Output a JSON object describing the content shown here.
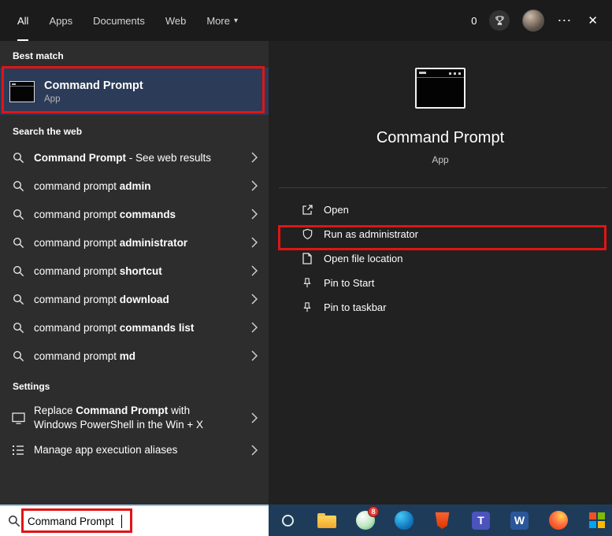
{
  "topbar": {
    "tabs": [
      {
        "label": "All"
      },
      {
        "label": "Apps"
      },
      {
        "label": "Documents"
      },
      {
        "label": "Web"
      },
      {
        "label": "More"
      }
    ],
    "rewards_count": "0"
  },
  "icons": {
    "caret_down": "▾",
    "ellipsis": "⋯",
    "close": "✕",
    "teams_letter": "T",
    "word_letter": "W"
  },
  "left": {
    "best_match_header": "Best match",
    "best_match": {
      "title": "Command Prompt",
      "subtitle": "App"
    },
    "search_web_header": "Search the web",
    "suggestions": [
      {
        "n1": "",
        "b": "Command Prompt",
        "n2": " - See web results"
      },
      {
        "n1": "command prompt ",
        "b": "admin",
        "n2": ""
      },
      {
        "n1": "command prompt ",
        "b": "commands",
        "n2": ""
      },
      {
        "n1": "command prompt ",
        "b": "administrator",
        "n2": ""
      },
      {
        "n1": "command prompt ",
        "b": "shortcut",
        "n2": ""
      },
      {
        "n1": "command prompt ",
        "b": "download",
        "n2": ""
      },
      {
        "n1": "command prompt ",
        "b": "commands list",
        "n2": ""
      },
      {
        "n1": "command prompt ",
        "b": "md",
        "n2": ""
      }
    ],
    "settings_header": "Settings",
    "settings": [
      {
        "n1": "Replace ",
        "b": "Command Prompt",
        "n2": " with Windows PowerShell in the Win + X"
      },
      {
        "n1": "Manage app execution aliases",
        "b": "",
        "n2": ""
      }
    ]
  },
  "right": {
    "app_title": "Command Prompt",
    "app_subtitle": "App",
    "actions": [
      {
        "label": "Open"
      },
      {
        "label": "Run as administrator"
      },
      {
        "label": "Open file location"
      },
      {
        "label": "Pin to Start"
      },
      {
        "label": "Pin to taskbar"
      }
    ]
  },
  "taskbar": {
    "search_value": "Command Prompt",
    "chrome_badge": "8",
    "apps": [
      "cortana",
      "file-explorer",
      "app-with-badge",
      "edge",
      "brave",
      "teams",
      "word",
      "firefox",
      "office"
    ]
  },
  "colors": {
    "annotation_red": "#e21414",
    "best_match_highlight": "#2c3b58",
    "taskbar_blue": "#1e3c5a",
    "search_accent": "#9cc3e5"
  }
}
